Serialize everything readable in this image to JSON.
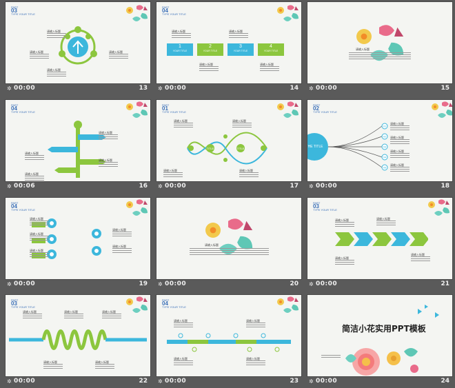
{
  "slides": [
    {
      "num": "13",
      "time": "00:00",
      "part": "PART",
      "pnum": "03",
      "sub": "TYPE YOUR TITLE"
    },
    {
      "num": "14",
      "time": "00:00",
      "part": "PART",
      "pnum": "04",
      "sub": "TYPE YOUR TITLE"
    },
    {
      "num": "15",
      "time": "00:00"
    },
    {
      "num": "16",
      "time": "00:06",
      "part": "PART",
      "pnum": "04",
      "sub": "TYPE YOUR TITLE"
    },
    {
      "num": "17",
      "time": "00:00",
      "part": "PART",
      "pnum": "01",
      "sub": "TYPE YOUR TITLE"
    },
    {
      "num": "18",
      "time": "00:00",
      "part": "PART",
      "pnum": "02",
      "sub": "TYPE YOUR TITLE"
    },
    {
      "num": "19",
      "time": "00:00",
      "part": "PART",
      "pnum": "04",
      "sub": "TYPE YOUR TITLE"
    },
    {
      "num": "20",
      "time": "00:00"
    },
    {
      "num": "21",
      "time": "00:00",
      "part": "PART",
      "pnum": "03",
      "sub": "TYPE YOUR TITLE"
    },
    {
      "num": "22",
      "time": "00:00",
      "part": "PART",
      "pnum": "03",
      "sub": "TYPE YOUR TITLE"
    },
    {
      "num": "23",
      "time": "00:00",
      "part": "PART",
      "pnum": "04",
      "sub": "TYPE YOUR TITLE"
    },
    {
      "num": "24",
      "time": "00:00"
    }
  ],
  "s14": {
    "boxes": [
      "1",
      "2",
      "3",
      "4"
    ],
    "box_label": "YOUR TITLE"
  },
  "s18": {
    "circle": "THE TITLE",
    "nodes": [
      "01",
      "02",
      "03",
      "04",
      "05"
    ]
  },
  "s17": {
    "center": "TITLE"
  },
  "s24": {
    "title": "简洁小花实用PPT模板"
  },
  "label": "请输入标题",
  "colors": {
    "blue": "#3cb7dc",
    "green": "#8cc63e",
    "accent": "#2b5ea7"
  }
}
